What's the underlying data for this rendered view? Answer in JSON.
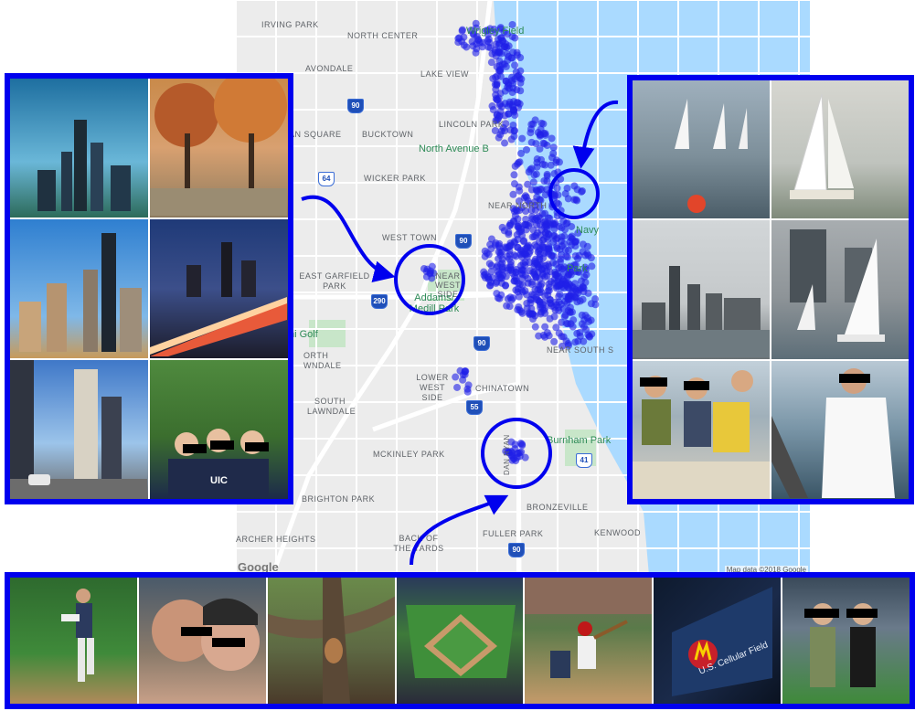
{
  "map": {
    "labels": {
      "irving_park": "IRVING PARK",
      "north_center": "NORTH CENTER",
      "wrigley_field": "Wrigley Field",
      "avondale": "AVONDALE",
      "lake_view": "LAKE VIEW",
      "lincoln_park": "LINCOLN PARK",
      "logan_square": "AN SQUARE",
      "bucktown": "BUCKTOWN",
      "north_avenue_beach": "North Avenue B",
      "wicker_park": "WICKER PARK",
      "near_north": "NEAR NORTH",
      "navy_pier": "Navy",
      "west_town": "WEST TOWN",
      "east_garfield_park": "EAST GARFIELD PARK",
      "near_west_side": "NEAR WEST SIDE",
      "addams_medill_park": "Addams/ Medill Park",
      "grant_park": "Park",
      "golf": "ni Golf",
      "north_lawndale": "ORTH WNDALE",
      "near_south_side": "NEAR SOUTH S",
      "lower_west_side": "LOWER WEST SIDE",
      "chinatown": "CHINATOWN",
      "south_lawndale": "SOUTH LAWNDALE",
      "burnham_park": "Burnham Park",
      "mckinley_park": "MCKINLEY PARK",
      "brighton_park": "BRIGHTON PARK",
      "bronzeville": "BRONZEVILLE",
      "archer_heights": "ARCHER HEIGHTS",
      "back_of_the_yards": "BACK OF THE YARDS",
      "fuller_park": "FULLER PARK",
      "kenwood": "KENWOOD",
      "dan_ryan": "Dan Ryan"
    },
    "shields": {
      "i90_north": "90",
      "r64": "64",
      "i90_mid": "90",
      "i290": "290",
      "i90_south": "90",
      "i55": "55",
      "r41": "41",
      "i90_far": "90"
    },
    "google_logo": "Google",
    "credit": "Map data ©2018 Google"
  },
  "colors": {
    "accent": "#0000ee",
    "dots": "#2020e8",
    "water": "#aadaff",
    "land": "#ececec",
    "park": "#c8e6c9"
  },
  "panels": {
    "left": {
      "photos": [
        "skyline-sears-tower",
        "autumn-park-walk",
        "downtown-skyline-sunny",
        "skyline-highway-dusk",
        "skyscrapers-street",
        "group-uic-shirts"
      ],
      "shirt_text": "UIC"
    },
    "right": {
      "photos": [
        "sailboats-regatta",
        "white-sailboat",
        "skyline-from-lake",
        "sailboats-near-towers",
        "crew-life-jackets",
        "man-on-boat"
      ]
    },
    "bottom": {
      "photos": [
        "pitcher-windup",
        "couple-selfie",
        "squirrel-in-tree",
        "stadium-aerial",
        "batter-swing",
        "us-cellular-field-sign",
        "women-on-field"
      ],
      "stadium_sign": "U.S. Cellular Field"
    }
  }
}
